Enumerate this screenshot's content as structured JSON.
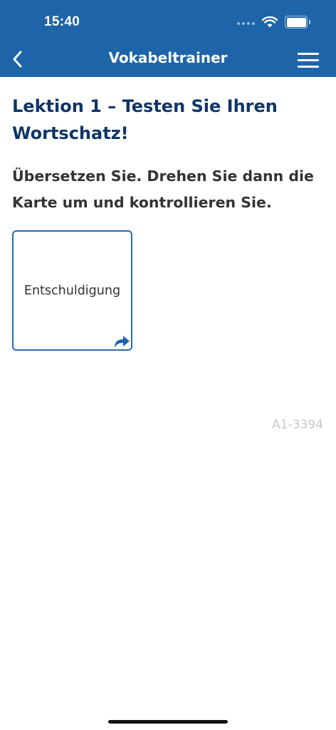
{
  "status_bar": {
    "time": "15:40"
  },
  "nav": {
    "title": "Vokabeltrainer",
    "back_icon": "chevron-left-icon",
    "menu_icon": "hamburger-menu-icon"
  },
  "lesson": {
    "title": "Lektion 1 – Testen Sie Ihren Wortschatz!",
    "instruction": "Übersetzen Sie. Drehen Sie dann die Karte um und kontrollieren Sie."
  },
  "flashcard": {
    "word": "Entschuldigung",
    "flip_icon": "flip-arrow-icon"
  },
  "card_id": "A1-3394",
  "colors": {
    "header_bg": "#1e64a8",
    "title_color": "#0f3566",
    "card_border": "#2a6aac",
    "text_color": "#333333",
    "id_color": "#c4c8cc"
  }
}
